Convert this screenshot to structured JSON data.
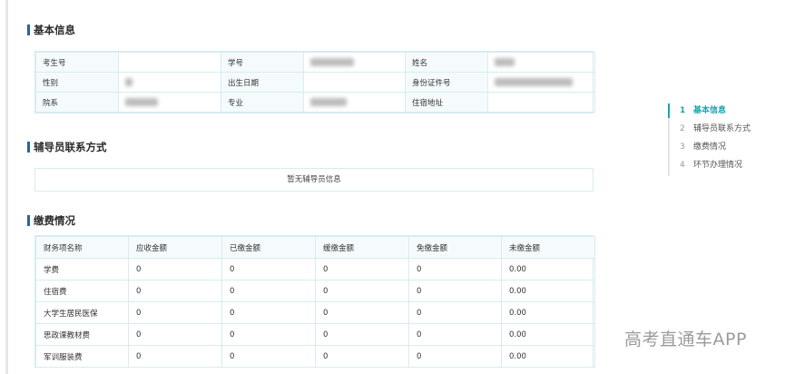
{
  "sections": {
    "basic": "基本信息",
    "counselor": "辅导员联系方式",
    "fees": "缴费情况"
  },
  "basic_info": {
    "rows": [
      [
        {
          "label": "考生号",
          "value": ""
        },
        {
          "label": "学号",
          "value": ""
        },
        {
          "label": "姓名",
          "value": ""
        }
      ],
      [
        {
          "label": "性别",
          "value": ""
        },
        {
          "label": "出生日期",
          "value": ""
        },
        {
          "label": "身份证件号",
          "value": ""
        }
      ],
      [
        {
          "label": "院系",
          "value": ""
        },
        {
          "label": "专业",
          "value": ""
        },
        {
          "label": "住宿地址",
          "value": ""
        }
      ]
    ]
  },
  "counselor": {
    "empty_message": "暂无辅导员信息"
  },
  "fees": {
    "headers": [
      "财务项名称",
      "应收金额",
      "已缴金额",
      "缓缴金额",
      "免缴金额",
      "未缴金额"
    ],
    "rows": [
      [
        "学费",
        "0",
        "0",
        "0",
        "0",
        "0.00"
      ],
      [
        "住宿费",
        "0",
        "0",
        "0",
        "0",
        "0.00"
      ],
      [
        "大学生居民医保",
        "0",
        "0",
        "0",
        "0",
        "0.00"
      ],
      [
        "思政课教材费",
        "0",
        "0",
        "0",
        "0",
        "0.00"
      ],
      [
        "军训服装费",
        "0",
        "0",
        "0",
        "0",
        "0.00"
      ]
    ]
  },
  "steps": [
    {
      "num": "1",
      "label": "基本信息",
      "active": true
    },
    {
      "num": "2",
      "label": "辅导员联系方式",
      "active": false
    },
    {
      "num": "3",
      "label": "缴费情况",
      "active": false
    },
    {
      "num": "4",
      "label": "环节办理情况",
      "active": false
    }
  ],
  "watermark": "高考直通车APP"
}
